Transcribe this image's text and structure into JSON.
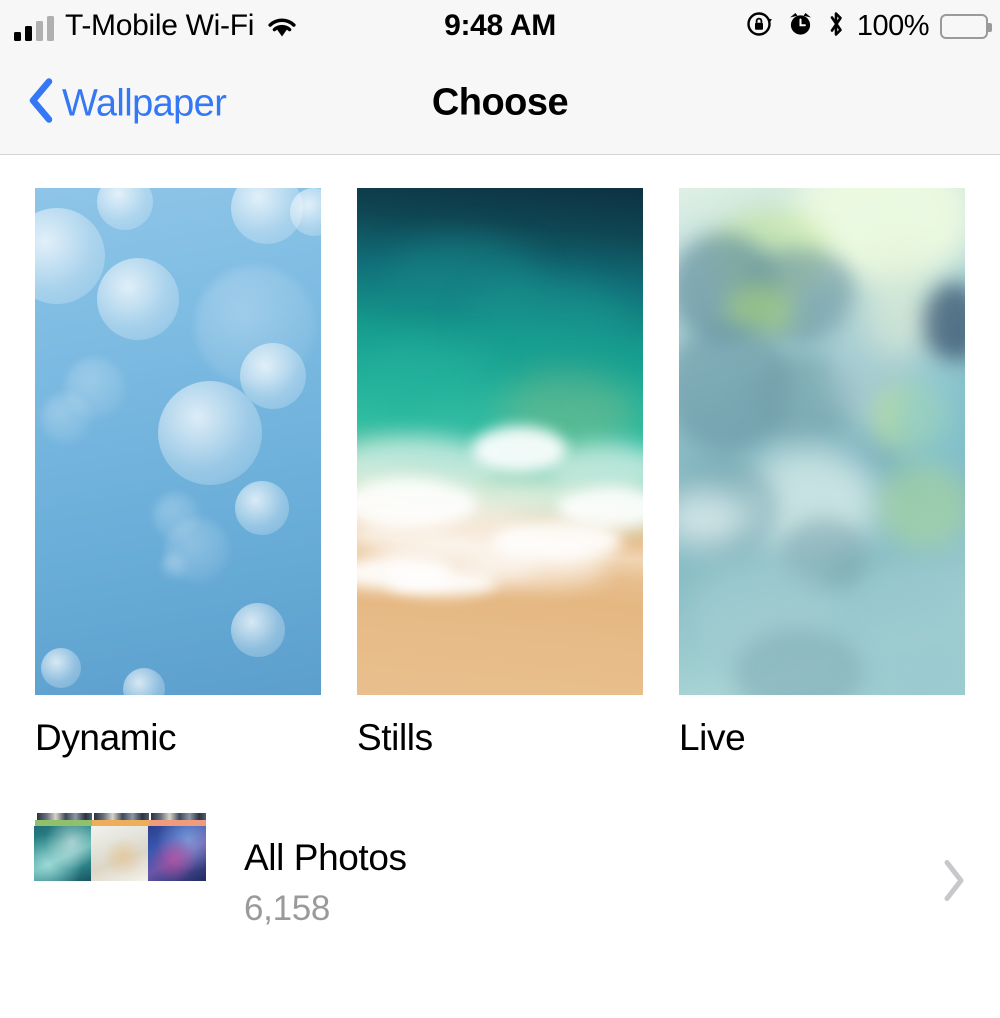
{
  "status_bar": {
    "carrier": "T-Mobile Wi-Fi",
    "wifi_icon": "wifi-icon",
    "signal_icon": "cellular-signal-icon",
    "signal_bars_filled": 2,
    "signal_bars_total": 4,
    "time": "9:48 AM",
    "rotation_lock_icon": "rotation-lock-icon",
    "alarm_icon": "alarm-clock-icon",
    "bluetooth_icon": "bluetooth-icon",
    "battery_percent": "100%",
    "battery_icon": "battery-full-icon",
    "background_color": "#f7f7f7"
  },
  "nav_bar": {
    "back_label": "Wallpaper",
    "back_icon": "chevron-left-icon",
    "title": "Choose",
    "tint_color": "#3478f6",
    "background_color": "#f7f7f7"
  },
  "wallpaper_categories": [
    {
      "label": "Dynamic",
      "thumb_name": "dynamic-wallpaper-thumbnail"
    },
    {
      "label": "Stills",
      "thumb_name": "stills-wallpaper-thumbnail"
    },
    {
      "label": "Live",
      "thumb_name": "live-wallpaper-thumbnail"
    }
  ],
  "all_photos": {
    "title": "All Photos",
    "count": "6,158",
    "disclosure_icon": "chevron-right-icon",
    "disclosure_color": "#c7c7cc",
    "count_color": "#9a9a9a",
    "thumbnails": [
      {
        "name": "photo-stack-thumbnail-1",
        "strip_color": "#8fc06a"
      },
      {
        "name": "photo-stack-thumbnail-2",
        "strip_color": "#eead5a"
      },
      {
        "name": "photo-stack-thumbnail-3",
        "strip_color": "#f09b7c"
      }
    ]
  }
}
